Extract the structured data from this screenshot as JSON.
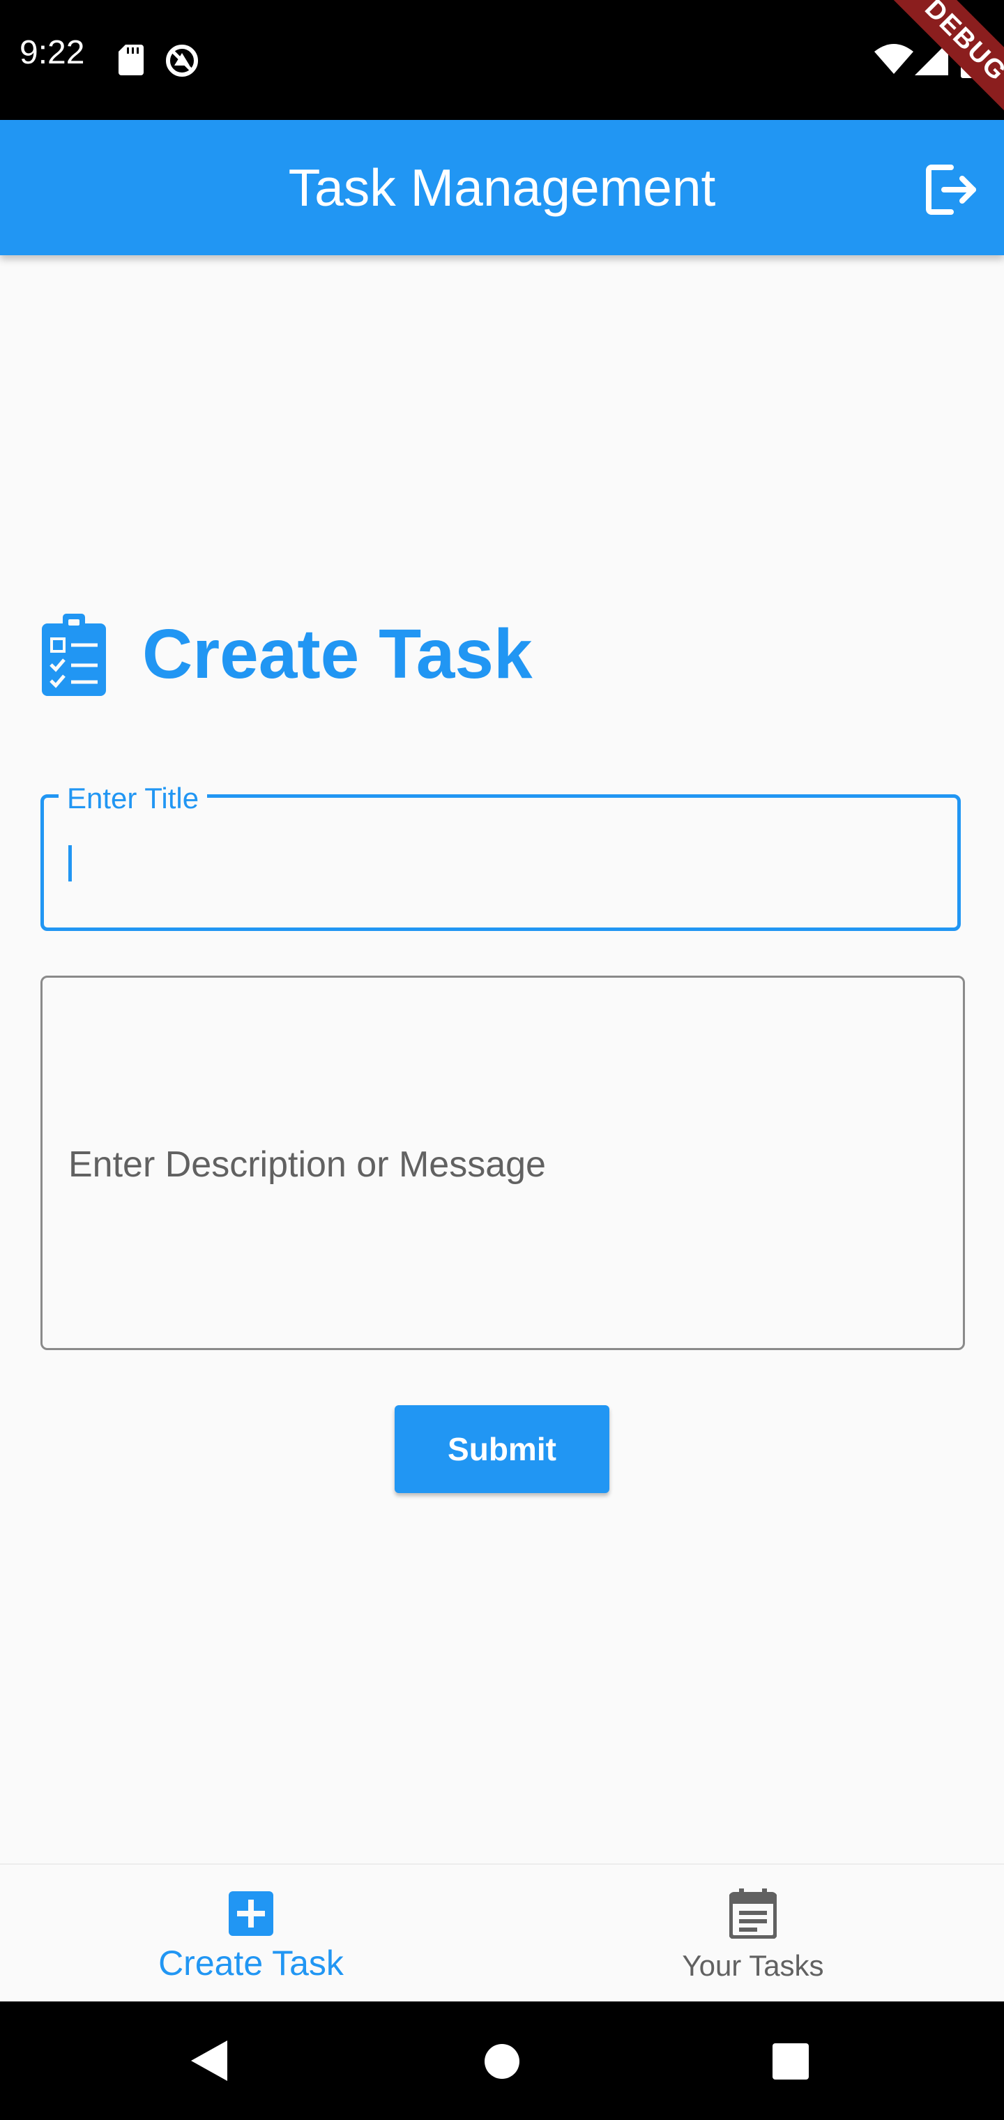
{
  "status_bar": {
    "time": "9:22",
    "icons": [
      "sd-card-icon",
      "sync-icon",
      "wifi-icon",
      "signal-icon",
      "battery-icon"
    ]
  },
  "debug_banner": "DEBUG",
  "app_bar": {
    "title": "Task Management",
    "action_icon": "logout-icon"
  },
  "form": {
    "heading": "Create Task",
    "heading_icon": "clipboard-checklist-icon",
    "title_field": {
      "label": "Enter Title",
      "value": ""
    },
    "description_field": {
      "placeholder": "Enter Description or Message",
      "value": ""
    },
    "submit_label": "Submit"
  },
  "bottom_nav": {
    "items": [
      {
        "label": "Create Task",
        "icon": "add-box-icon",
        "active": true
      },
      {
        "label": "Your Tasks",
        "icon": "calendar-note-icon",
        "active": false
      }
    ]
  },
  "colors": {
    "primary": "#2196F3",
    "inactive": "#616161",
    "background": "#fafafa"
  }
}
